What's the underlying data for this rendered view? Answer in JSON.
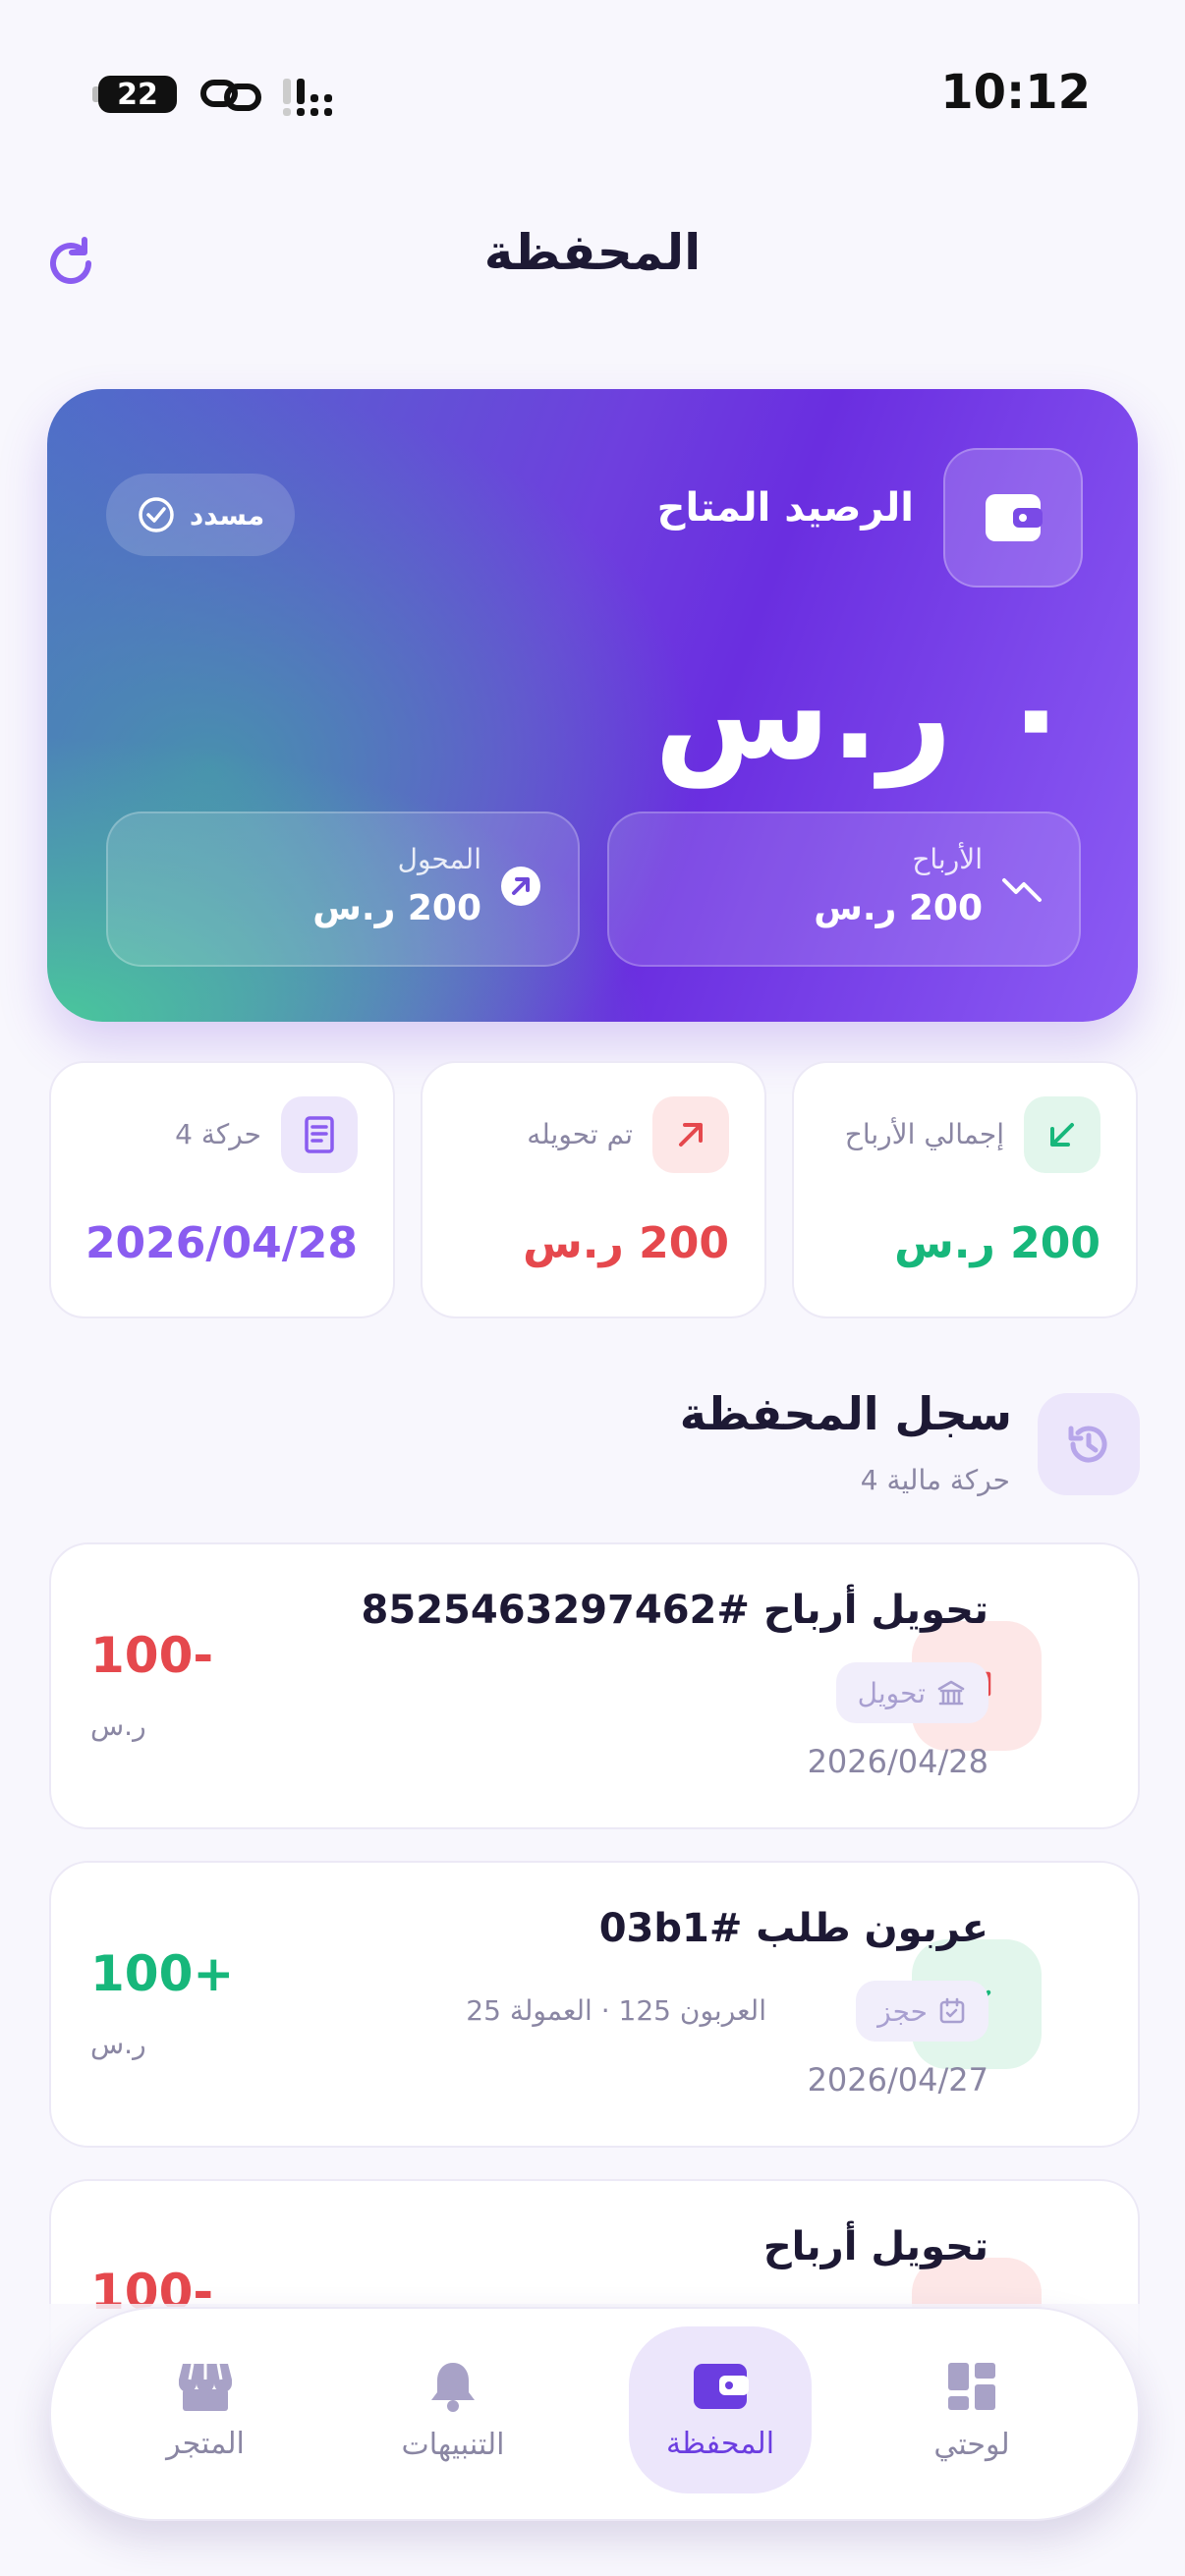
{
  "status_bar": {
    "time": "10:12",
    "battery": "22"
  },
  "header": {
    "title": "المحفظة"
  },
  "balance_card": {
    "label": "الرصيد المتاح",
    "verified": "مسدد",
    "amount": "٠ ر.س",
    "profits": {
      "label": "الأرباح",
      "value": "200 ر.س"
    },
    "transferred": {
      "label": "المحول",
      "value": "200 ر.س"
    }
  },
  "stats": [
    {
      "label": "إجمالي الأرباح",
      "value": "200 ر.س",
      "color": "#17b77b"
    },
    {
      "label": "تم تحويله",
      "value": "200 ر.س",
      "color": "#e5484d"
    },
    {
      "label": "4 حركة",
      "value": "2026/04/28",
      "color": "#8a5cf0"
    }
  ],
  "history": {
    "title": "سجل المحفظة",
    "subtitle": "4 حركة مالية"
  },
  "transactions": [
    {
      "title": "تحويل أرباح #8525463297462",
      "tag": "تحويل",
      "extra": "",
      "date": "2026/04/28",
      "amount": "100-",
      "currency": "ر.س",
      "type": "out"
    },
    {
      "title": "عربون طلب #03b1",
      "tag": "حجز",
      "extra": "العربون 125 · العمولة 25",
      "date": "2026/04/27",
      "amount": "100+",
      "currency": "ر.س",
      "type": "in"
    },
    {
      "title": "تحويل أرباح",
      "tag": "",
      "extra": "",
      "date": "",
      "amount": "100-",
      "currency": "",
      "type": "out"
    }
  ],
  "nav": {
    "dashboard": "لوحتي",
    "wallet": "المحفظة",
    "notifications": "التنبيهات",
    "store": "المتجر"
  },
  "colors": {
    "accent": "#6b3de0",
    "positive": "#17b77b",
    "negative": "#e5484d"
  }
}
